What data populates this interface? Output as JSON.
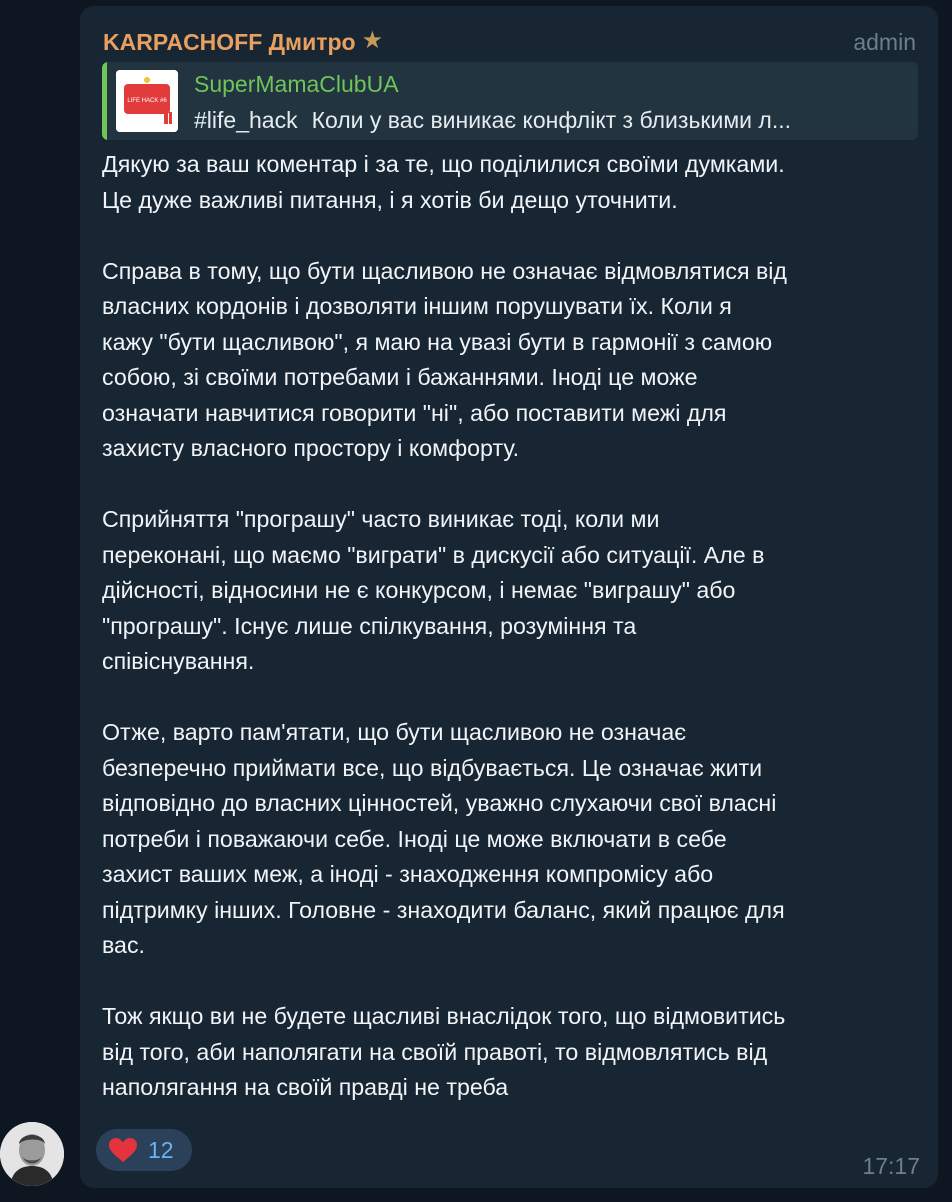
{
  "message": {
    "sender_name": "KARPACHOFF Дмитро",
    "sender_icon": "star-icon",
    "sender_role": "admin",
    "sender_color": "#e8a060",
    "reply": {
      "channel_name": "SuperMamaClubUA",
      "tag": "#life_hack",
      "preview_text": "Коли у вас виникає конфлікт з близькими л...",
      "thumbnail_label": "LIFE HACK #6",
      "accent_color": "#6fc45a"
    },
    "paragraphs": [
      {
        "lines": [
          "Дякую за ваш коментар і за те, що поділилися своїми думками.",
          "Це дуже важливі питання, і я хотів би дещо уточнити."
        ]
      },
      {
        "lines": [
          "Справа в тому, що бути щасливою не означає відмовлятися від",
          "власних кордонів і дозволяти іншим порушувати їх. Коли я",
          "кажу \"бути щасливою\", я маю на увазі бути в гармонії з самою",
          "собою, зі своїми потребами і бажаннями. Іноді це може",
          "означати навчитися говорити \"ні\", або поставити межі для",
          "захисту власного простору і комфорту."
        ]
      },
      {
        "lines": [
          "Сприйняття \"програшу\" часто виникає тоді, коли ми",
          "переконані, що маємо \"виграти\" в дискусії або ситуації. Але в",
          "дійсності, відносини не є конкурсом, і немає \"виграшу\" або",
          "\"програшу\". Існує лише спілкування, розуміння та",
          "співіснування."
        ]
      },
      {
        "lines": [
          "Отже, варто пам'ятати, що бути щасливою не означає",
          "безперечно приймати все, що відбувається. Це означає жити",
          "відповідно до власних цінностей, уважно слухаючи свої власні",
          "потреби і поважаючи себе. Іноді це може включати в себе",
          "захист ваших меж, а іноді - знаходження компромісу або",
          "підтримку інших. Головне - знаходити баланс, який працює для",
          "вас."
        ]
      },
      {
        "lines": [
          "Тож якщо ви не будете щасливі внаслідок того, що відмовитись",
          "від того, аби наполягати на своїй правоті, то відмовлятись від",
          "наполягання на своїй правді не треба"
        ]
      }
    ],
    "reaction": {
      "icon": "heart-icon",
      "count": "12"
    },
    "time": "17:17"
  },
  "colors": {
    "background": "#0e1621",
    "bubble": "#182533",
    "text": "#f0f4f8",
    "muted": "#6d7f8f",
    "reaction_bg": "#2b4159",
    "reaction_count": "#6ab3f3",
    "heart": "#e5333d"
  }
}
